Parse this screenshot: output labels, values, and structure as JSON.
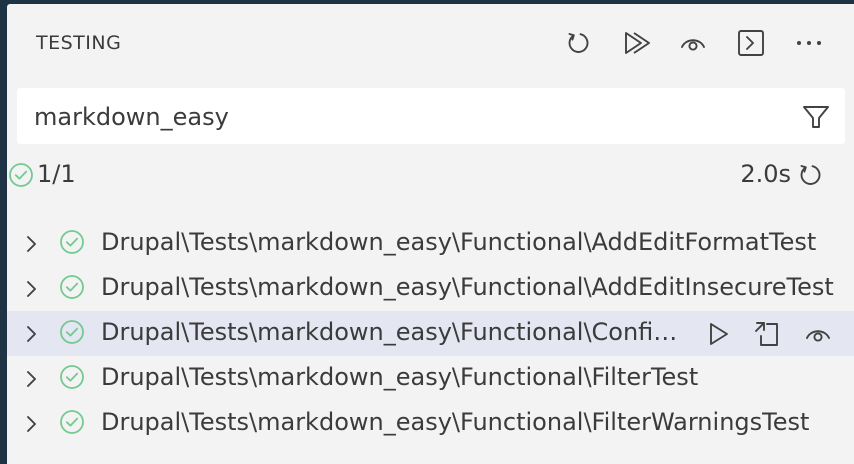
{
  "panel": {
    "title": "TESTING",
    "toolbar": [
      {
        "icon": "refresh-icon",
        "tooltip": "Refresh Tests"
      },
      {
        "icon": "run-all-icon",
        "tooltip": "Run Tests"
      },
      {
        "icon": "eye-icon",
        "tooltip": "Toggle Continuous Run"
      },
      {
        "icon": "terminal-icon",
        "tooltip": "Show Output"
      },
      {
        "icon": "more-actions-icon",
        "tooltip": "More Actions"
      }
    ]
  },
  "filter": {
    "value": "markdown_easy",
    "icon": "filter-icon"
  },
  "summary": {
    "count": "1/1",
    "duration": "2.0s",
    "status_icon": "passed-icon",
    "rerun_icon": "refresh-icon"
  },
  "tests": [
    {
      "label": "Drupal\\Tests\\markdown_easy\\Functional\\AddEditFormatTest",
      "status": "passed",
      "hovered": false
    },
    {
      "label": "Drupal\\Tests\\markdown_easy\\Functional\\AddEditInsecureTest",
      "status": "passed",
      "hovered": false
    },
    {
      "label": "Drupal\\Tests\\markdown_easy\\Functional\\ConfigTest",
      "status": "passed",
      "hovered": true
    },
    {
      "label": "Drupal\\Tests\\markdown_easy\\Functional\\FilterTest",
      "status": "passed",
      "hovered": false
    },
    {
      "label": "Drupal\\Tests\\markdown_easy\\Functional\\FilterWarningsTest",
      "status": "passed",
      "hovered": false
    }
  ],
  "row_actions": [
    "run-test-icon",
    "go-to-test-icon",
    "watch-test-icon"
  ],
  "colors": {
    "pass": "#73c991",
    "text": "#3b3b3b",
    "panel_bg": "#f3f3f3",
    "hover_bg": "#e4e6f1",
    "frame_bg": "#1e3344"
  }
}
